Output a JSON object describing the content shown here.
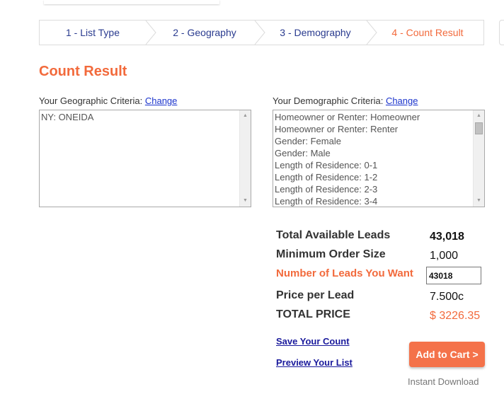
{
  "steps": [
    {
      "label": "1 - List Type",
      "active": false
    },
    {
      "label": "2 - Geography",
      "active": false
    },
    {
      "label": "3 - Demography",
      "active": false
    },
    {
      "label": "4 - Count Result",
      "active": true
    }
  ],
  "page_title": "Count Result",
  "geo": {
    "label": "Your Geographic Criteria:",
    "change": "Change",
    "items": [
      "NY: ONEIDA"
    ]
  },
  "demo": {
    "label": "Your Demographic Criteria:",
    "change": "Change",
    "items": [
      "Homeowner or Renter: Homeowner",
      "Homeowner or Renter: Renter",
      "Gender: Female",
      "Gender: Male",
      "Length of Residence: 0-1",
      "Length of Residence: 1-2",
      "Length of Residence: 2-3",
      "Length of Residence: 3-4"
    ]
  },
  "summary": {
    "available_label": "Total Available Leads",
    "available_value": "43,018",
    "min_label": "Minimum Order Size",
    "min_value": "1,000",
    "want_label": "Number of Leads You Want",
    "want_value": "43018",
    "price_label": "Price per Lead",
    "price_value": "7.500c",
    "total_label": "TOTAL PRICE",
    "total_value": "$ 3226.35"
  },
  "actions": {
    "save": "Save Your Count",
    "preview": "Preview Your List",
    "cart": "Add to Cart >",
    "instant": "Instant Download"
  },
  "colors": {
    "accent": "#f26a3c",
    "link": "#1a33cc",
    "step_text": "#2a3b8f"
  }
}
